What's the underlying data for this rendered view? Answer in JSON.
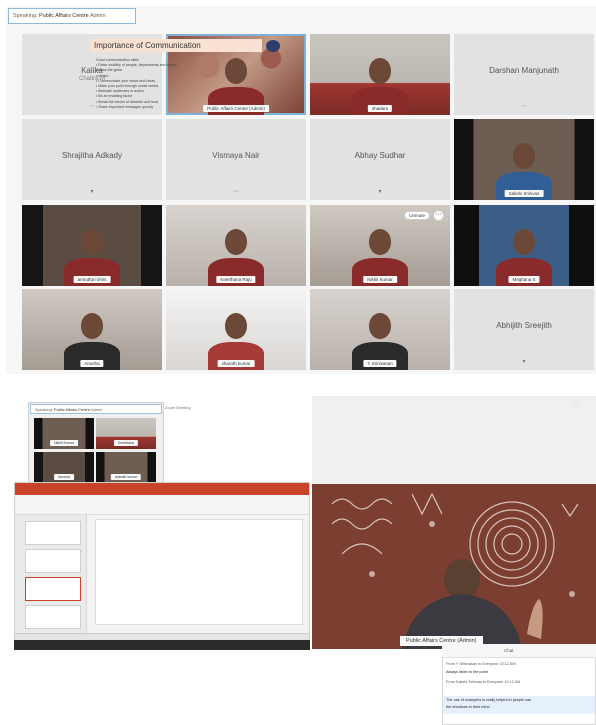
{
  "top_panel": {
    "speaking": {
      "label": "Speaking:",
      "name": "Public Affairs Centre",
      "suffix": "Admin"
    },
    "tiles": [
      {
        "type": "name",
        "name": "Kalika",
        "sub": "Chaitra M",
        "mic": "⋯"
      },
      {
        "type": "video",
        "tag": "Public Affairs Centre (Admin)",
        "bg": "art",
        "active": true
      },
      {
        "type": "video",
        "tag": "shadaru",
        "bg": "wall"
      },
      {
        "type": "name",
        "name": "Darshan Manjunath",
        "mic": "⋯"
      },
      {
        "type": "name",
        "name": "Shrajitha Adkady",
        "mic": "▾"
      },
      {
        "type": "name",
        "name": "Vismaya Nair",
        "mic": "⋯"
      },
      {
        "type": "name",
        "name": "Abhay Sudhar",
        "mic": "▾"
      },
      {
        "type": "video",
        "tag": "Sakshi Srinivas",
        "bg": "dark2",
        "body": "blue"
      },
      {
        "type": "video",
        "tag": "amrutha rohini",
        "bg": "dark"
      },
      {
        "type": "video",
        "tag": "Keerthana Raju",
        "bg": "room"
      },
      {
        "type": "video",
        "tag": "Nikhil Kumar",
        "bg": "grey",
        "pin": "Unmute",
        "more": "⋯"
      },
      {
        "type": "video",
        "tag": "Meghana S",
        "bg": "blue"
      },
      {
        "type": "video",
        "tag": "Anusha",
        "bg": "grey",
        "body": "dark"
      },
      {
        "type": "video",
        "tag": "sharath kumar",
        "bg": "white",
        "body": "red"
      },
      {
        "type": "video",
        "tag": "Y Srinivasan",
        "bg": "room",
        "body": "dark"
      },
      {
        "type": "name",
        "name": "Abhijith Sreejith",
        "mic": "▾"
      }
    ]
  },
  "mini_panel": {
    "speaking": {
      "label": "Speaking:",
      "name": "Public Affairs Centre",
      "suffix": "Admin"
    },
    "title": "Zoom Meeting",
    "tiles": [
      {
        "tag": "Nikhil Kumar"
      },
      {
        "tag": "Keerthana"
      },
      {
        "tag": "Anusha"
      },
      {
        "tag": "sharath kumar"
      }
    ]
  },
  "slide": {
    "title": "Importance of Communication",
    "bullets": [
      "Good communication skills",
      "• Raise visibility of people, departments and issues",
      "  across the globe",
      "• Inform",
      "• Communicate your views and ideas",
      "• Make your point through social media",
      "• Motivate audiences to action",
      "• Be an enabling factor",
      "• Break the barrier of disbelief and trust",
      "• Share important messages quickly"
    ]
  },
  "big_video": {
    "tag": "Public Affairs Centre (Admin)"
  },
  "chat": {
    "header": "Chat",
    "messages": [
      {
        "text": "From Y Srinivasan to Everyone  10:12 AM",
        "strong": false
      },
      {
        "text": "Always listen to the point",
        "strong": true
      },
      {
        "text": "From Sakshi Srinivas to Everyone  10:12 AM",
        "strong": false
      },
      {
        "text": "The use of examples is really helpful to people can",
        "strong": true
      },
      {
        "text": "the emotions in their mind",
        "strong": true
      }
    ]
  },
  "colors": {
    "highlight": "#7fb2d8",
    "ppt_accent": "#c9432a"
  }
}
